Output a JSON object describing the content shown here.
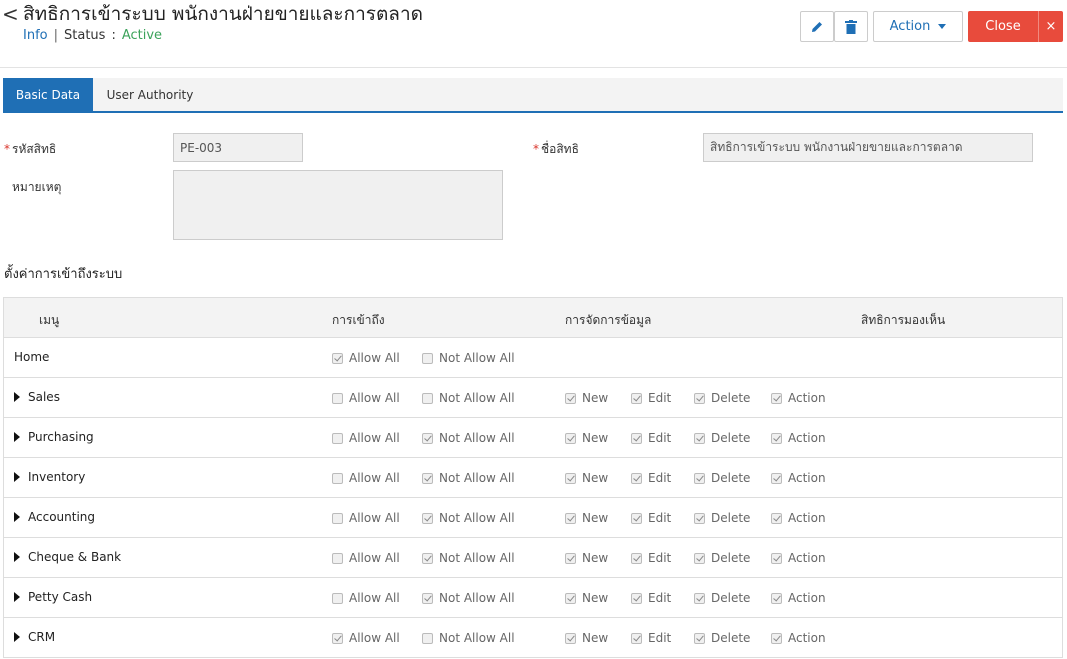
{
  "header": {
    "back_glyph": "<",
    "title": "สิทธิการเข้าระบบ พนักงานฝ่ายขายและการตลาด",
    "info_label": "Info",
    "separator": "|",
    "status_label": "Status",
    "status_colon": ":",
    "status_value": "Active",
    "action_label": "Action",
    "close_label": "Close",
    "close_x": "×"
  },
  "tabs": [
    {
      "label": "Basic Data"
    },
    {
      "label": "User Authority"
    }
  ],
  "form": {
    "code_label": "รหัสสิทธิ",
    "code_value": "PE-003",
    "name_label": "ชื่อสิทธิ",
    "name_value": "สิทธิการเข้าระบบ พนักงานฝ่ายขายและการตลาด",
    "remark_label": "หมายเหตุ",
    "remark_value": "",
    "required_mark": "*"
  },
  "section_title": "ตั้งค่าการเข้าถึงระบบ",
  "table": {
    "headers": {
      "menu": "เมนู",
      "access": "การเข้าถึง",
      "manage": "การจัดการข้อมูล",
      "visibility": "สิทธิการมองเห็น"
    },
    "option_labels": {
      "allow": "Allow All",
      "not_allow": "Not Allow All",
      "new": "New",
      "edit": "Edit",
      "delete": "Delete",
      "action": "Action"
    },
    "rows": [
      {
        "name": "Home",
        "expandable": false,
        "allow": true,
        "not_allow": false,
        "manage": false
      },
      {
        "name": "Sales",
        "expandable": true,
        "allow": false,
        "not_allow": false,
        "manage": true
      },
      {
        "name": "Purchasing",
        "expandable": true,
        "allow": false,
        "not_allow": true,
        "manage": true
      },
      {
        "name": "Inventory",
        "expandable": true,
        "allow": false,
        "not_allow": true,
        "manage": true
      },
      {
        "name": "Accounting",
        "expandable": true,
        "allow": false,
        "not_allow": true,
        "manage": true
      },
      {
        "name": "Cheque & Bank",
        "expandable": true,
        "allow": false,
        "not_allow": true,
        "manage": true
      },
      {
        "name": "Petty Cash",
        "expandable": true,
        "allow": false,
        "not_allow": true,
        "manage": true
      },
      {
        "name": "CRM",
        "expandable": true,
        "allow": true,
        "not_allow": false,
        "manage": true
      }
    ]
  },
  "colors": {
    "primary": "#1f6fb5",
    "danger": "#e84b3c",
    "active": "#3ca35b"
  }
}
